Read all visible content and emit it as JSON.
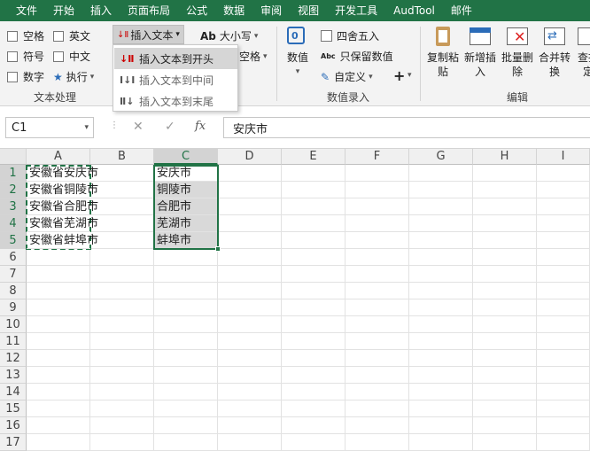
{
  "menu": [
    "文件",
    "开始",
    "插入",
    "页面布局",
    "公式",
    "数据",
    "审阅",
    "视图",
    "开发工具",
    "AudTool",
    "邮件"
  ],
  "ribbon": {
    "checks": [
      "空格",
      "英文",
      "符号",
      "中文",
      "数字",
      "执行"
    ],
    "insert_text": "插入文本",
    "case_label": "大小写",
    "space_label": "空格",
    "group1": "文本处理",
    "value_btn": "数值",
    "round": "四舍五入",
    "keep_value": "只保留数值",
    "custom": "自定义",
    "group2": "数值录入",
    "big_buttons": [
      {
        "line1": "复制粘",
        "line2": "贴"
      },
      {
        "line1": "新增插",
        "line2": "入"
      },
      {
        "line1": "批量删",
        "line2": "除"
      },
      {
        "line1": "合并转",
        "line2": "换"
      },
      {
        "line1": "查找",
        "line2": "定"
      }
    ],
    "group3": "编辑"
  },
  "dropdown": {
    "items": [
      "插入文本到开头",
      "插入文本到中间",
      "插入文本到末尾"
    ]
  },
  "formula": {
    "name_box": "C1",
    "content": "安庆市"
  },
  "columns": [
    "A",
    "B",
    "C",
    "D",
    "E",
    "F",
    "G",
    "H",
    "I"
  ],
  "rows": [
    "1",
    "2",
    "3",
    "4",
    "5",
    "6",
    "7",
    "8",
    "9",
    "10",
    "11",
    "12",
    "13",
    "14",
    "15",
    "16",
    "17"
  ],
  "col_a": [
    "安徽省安庆市",
    "安徽省铜陵市",
    "安徽省合肥市",
    "安徽省芜湖市",
    "安徽省蚌埠市"
  ],
  "col_c": [
    "安庆市",
    "铜陵市",
    "合肥市",
    "芜湖市",
    "蚌埠市"
  ]
}
